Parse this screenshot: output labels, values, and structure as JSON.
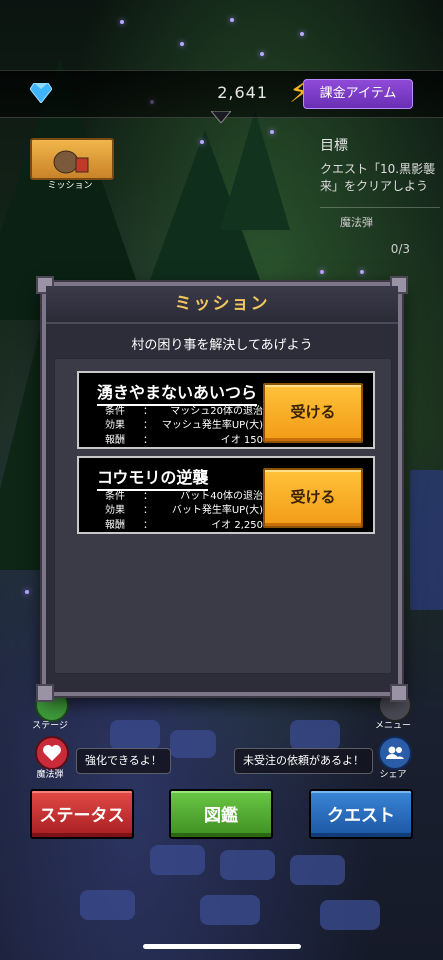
{
  "topbar": {
    "gem_count": "2,641",
    "shop_label": "課金アイテム"
  },
  "mission_icon": {
    "label": "ミッション"
  },
  "objective": {
    "heading": "目標",
    "text": "クエスト「10.黒影襲来」をクリアしよう",
    "target": "魔法弾",
    "progress": "0/3"
  },
  "modal": {
    "title": "ミッション",
    "subtitle": "村の困り事を解決してあげよう",
    "missions": [
      {
        "title": "湧きやまないあいつら",
        "condition_key": "条件",
        "condition": "マッシュ20体の退治",
        "effect_key": "効果",
        "effect": "マッシュ発生率UP(大)",
        "reward_key": "報酬",
        "reward": "イオ 150",
        "button": "受ける"
      },
      {
        "title": "コウモリの逆襲",
        "condition_key": "条件",
        "condition": "バット40体の退治",
        "effect_key": "効果",
        "effect": "バット発生率UP(大)",
        "reward_key": "報酬",
        "reward": "イオ 2,250",
        "button": "受ける"
      }
    ]
  },
  "side": {
    "stage_label": "ステージ",
    "menu_label": "メニュー",
    "magic_label": "魔法弾",
    "share_label": "シェア"
  },
  "bubbles": {
    "left": "強化できるよ！",
    "right": "未受注の依頼があるよ！"
  },
  "bottom": {
    "status": "ステータス",
    "book": "図鑑",
    "quest": "クエスト"
  },
  "colors": {
    "accent_gold": "#f2c75e",
    "button_orange": "#f29b16",
    "shop_purple": "#8f4bd8"
  }
}
